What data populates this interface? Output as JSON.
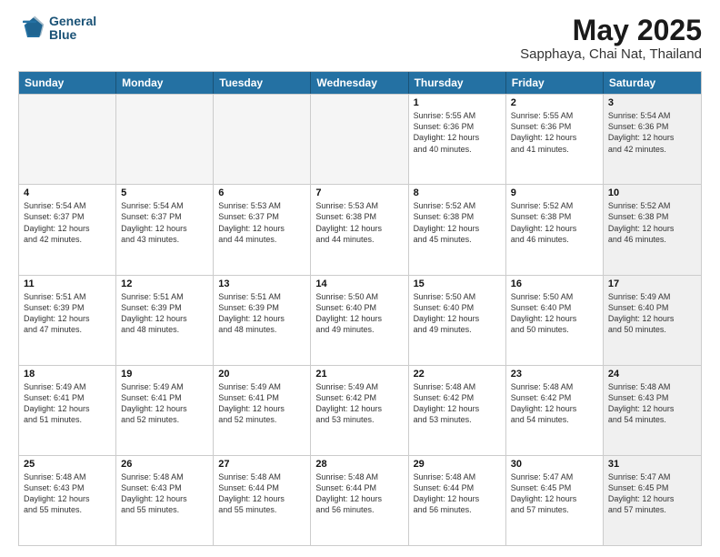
{
  "logo": {
    "line1": "General",
    "line2": "Blue"
  },
  "title": "May 2025",
  "subtitle": "Sapphaya, Chai Nat, Thailand",
  "header_days": [
    "Sunday",
    "Monday",
    "Tuesday",
    "Wednesday",
    "Thursday",
    "Friday",
    "Saturday"
  ],
  "rows": [
    [
      {
        "day": "",
        "text": "",
        "empty": true
      },
      {
        "day": "",
        "text": "",
        "empty": true
      },
      {
        "day": "",
        "text": "",
        "empty": true
      },
      {
        "day": "",
        "text": "",
        "empty": true
      },
      {
        "day": "1",
        "text": "Sunrise: 5:55 AM\nSunset: 6:36 PM\nDaylight: 12 hours\nand 40 minutes."
      },
      {
        "day": "2",
        "text": "Sunrise: 5:55 AM\nSunset: 6:36 PM\nDaylight: 12 hours\nand 41 minutes."
      },
      {
        "day": "3",
        "text": "Sunrise: 5:54 AM\nSunset: 6:36 PM\nDaylight: 12 hours\nand 42 minutes.",
        "shade": true
      }
    ],
    [
      {
        "day": "4",
        "text": "Sunrise: 5:54 AM\nSunset: 6:37 PM\nDaylight: 12 hours\nand 42 minutes."
      },
      {
        "day": "5",
        "text": "Sunrise: 5:54 AM\nSunset: 6:37 PM\nDaylight: 12 hours\nand 43 minutes."
      },
      {
        "day": "6",
        "text": "Sunrise: 5:53 AM\nSunset: 6:37 PM\nDaylight: 12 hours\nand 44 minutes."
      },
      {
        "day": "7",
        "text": "Sunrise: 5:53 AM\nSunset: 6:38 PM\nDaylight: 12 hours\nand 44 minutes."
      },
      {
        "day": "8",
        "text": "Sunrise: 5:52 AM\nSunset: 6:38 PM\nDaylight: 12 hours\nand 45 minutes."
      },
      {
        "day": "9",
        "text": "Sunrise: 5:52 AM\nSunset: 6:38 PM\nDaylight: 12 hours\nand 46 minutes."
      },
      {
        "day": "10",
        "text": "Sunrise: 5:52 AM\nSunset: 6:38 PM\nDaylight: 12 hours\nand 46 minutes.",
        "shade": true
      }
    ],
    [
      {
        "day": "11",
        "text": "Sunrise: 5:51 AM\nSunset: 6:39 PM\nDaylight: 12 hours\nand 47 minutes."
      },
      {
        "day": "12",
        "text": "Sunrise: 5:51 AM\nSunset: 6:39 PM\nDaylight: 12 hours\nand 48 minutes."
      },
      {
        "day": "13",
        "text": "Sunrise: 5:51 AM\nSunset: 6:39 PM\nDaylight: 12 hours\nand 48 minutes."
      },
      {
        "day": "14",
        "text": "Sunrise: 5:50 AM\nSunset: 6:40 PM\nDaylight: 12 hours\nand 49 minutes."
      },
      {
        "day": "15",
        "text": "Sunrise: 5:50 AM\nSunset: 6:40 PM\nDaylight: 12 hours\nand 49 minutes."
      },
      {
        "day": "16",
        "text": "Sunrise: 5:50 AM\nSunset: 6:40 PM\nDaylight: 12 hours\nand 50 minutes."
      },
      {
        "day": "17",
        "text": "Sunrise: 5:49 AM\nSunset: 6:40 PM\nDaylight: 12 hours\nand 50 minutes.",
        "shade": true
      }
    ],
    [
      {
        "day": "18",
        "text": "Sunrise: 5:49 AM\nSunset: 6:41 PM\nDaylight: 12 hours\nand 51 minutes."
      },
      {
        "day": "19",
        "text": "Sunrise: 5:49 AM\nSunset: 6:41 PM\nDaylight: 12 hours\nand 52 minutes."
      },
      {
        "day": "20",
        "text": "Sunrise: 5:49 AM\nSunset: 6:41 PM\nDaylight: 12 hours\nand 52 minutes."
      },
      {
        "day": "21",
        "text": "Sunrise: 5:49 AM\nSunset: 6:42 PM\nDaylight: 12 hours\nand 53 minutes."
      },
      {
        "day": "22",
        "text": "Sunrise: 5:48 AM\nSunset: 6:42 PM\nDaylight: 12 hours\nand 53 minutes."
      },
      {
        "day": "23",
        "text": "Sunrise: 5:48 AM\nSunset: 6:42 PM\nDaylight: 12 hours\nand 54 minutes."
      },
      {
        "day": "24",
        "text": "Sunrise: 5:48 AM\nSunset: 6:43 PM\nDaylight: 12 hours\nand 54 minutes.",
        "shade": true
      }
    ],
    [
      {
        "day": "25",
        "text": "Sunrise: 5:48 AM\nSunset: 6:43 PM\nDaylight: 12 hours\nand 55 minutes."
      },
      {
        "day": "26",
        "text": "Sunrise: 5:48 AM\nSunset: 6:43 PM\nDaylight: 12 hours\nand 55 minutes."
      },
      {
        "day": "27",
        "text": "Sunrise: 5:48 AM\nSunset: 6:44 PM\nDaylight: 12 hours\nand 55 minutes."
      },
      {
        "day": "28",
        "text": "Sunrise: 5:48 AM\nSunset: 6:44 PM\nDaylight: 12 hours\nand 56 minutes."
      },
      {
        "day": "29",
        "text": "Sunrise: 5:48 AM\nSunset: 6:44 PM\nDaylight: 12 hours\nand 56 minutes."
      },
      {
        "day": "30",
        "text": "Sunrise: 5:47 AM\nSunset: 6:45 PM\nDaylight: 12 hours\nand 57 minutes."
      },
      {
        "day": "31",
        "text": "Sunrise: 5:47 AM\nSunset: 6:45 PM\nDaylight: 12 hours\nand 57 minutes.",
        "shade": true
      }
    ]
  ]
}
